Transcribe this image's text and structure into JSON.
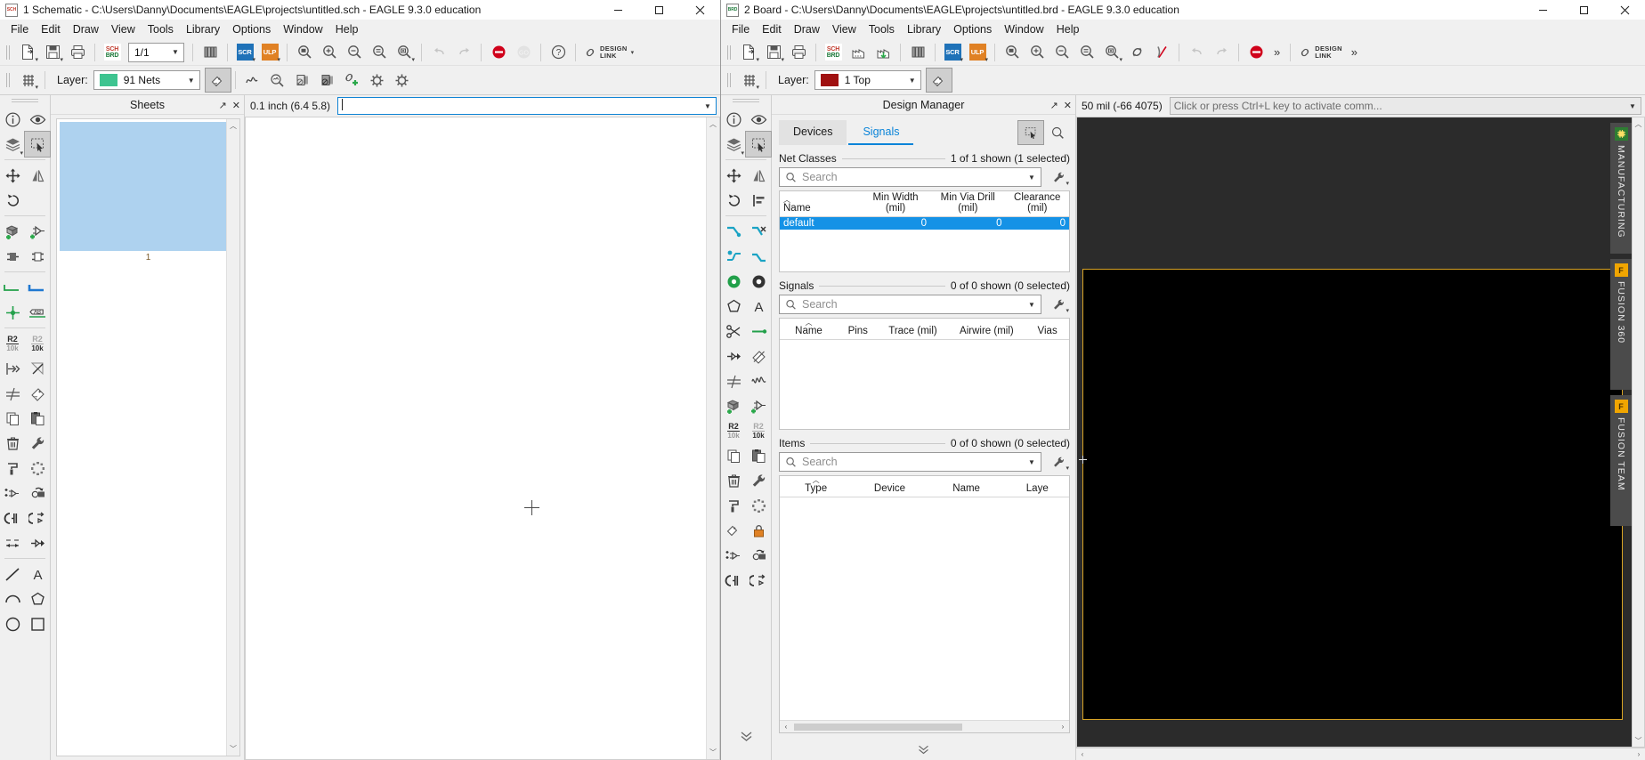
{
  "schematic_window": {
    "title": "1 Schematic - C:\\Users\\Danny\\Documents\\EAGLE\\projects\\untitled.sch - EAGLE 9.3.0 education",
    "title_icon": "sch-file-icon",
    "window_buttons": {
      "minimize": "minimize-icon",
      "maximize": "maximize-icon",
      "close": "close-icon"
    },
    "menu": [
      "File",
      "Edit",
      "Draw",
      "View",
      "Tools",
      "Library",
      "Options",
      "Window",
      "Help"
    ],
    "toolbar": {
      "buttons": [
        {
          "name": "new-file-icon",
          "kind": "newfile"
        },
        {
          "name": "save-icon",
          "kind": "save"
        },
        {
          "name": "print-icon",
          "kind": "print"
        },
        {
          "name": "switch-to-board-icon",
          "kind": "schbrd"
        }
      ],
      "sheet_selector": "1/1",
      "library_icon": "library-icon",
      "script_label": "SCR",
      "ulp_label": "ULP",
      "zoom_buttons": [
        "zoom-fit-icon",
        "zoom-in-icon",
        "zoom-out-icon",
        "zoom-select-icon",
        "zoom-redraw-icon"
      ],
      "undo_icon": "undo-icon",
      "redo_icon": "redo-icon",
      "stop_icon": "stop-icon",
      "go_icon": "go-icon",
      "help_icon": "help-icon",
      "design_link_line1": "DESIGN",
      "design_link_line2": "LINK"
    },
    "layerbar": {
      "grid_icon": "grid-icon",
      "layer_label": "Layer:",
      "layer_value": "91 Nets",
      "layer_color": "#3ec490",
      "layer_settings_icon": "layer-settings-icon",
      "tools": [
        "signal-icon",
        "inspect-icon",
        "erc-icon",
        "drc-icon",
        "attach-icon",
        "gear-icon",
        "gear-alt-icon"
      ]
    },
    "palette": [
      [
        "info-icon",
        "show-icon"
      ],
      [
        "layers-icon",
        "group-select-icon"
      ],
      [
        "move-icon",
        "mirror-icon"
      ],
      [
        "rotate-icon",
        null
      ],
      [
        "add-part-icon",
        "add-gate-icon"
      ],
      [
        "device-icon",
        "package-icon"
      ],
      [
        "net-icon",
        "bus-icon"
      ],
      [
        "junction-icon",
        "label-icon"
      ],
      [
        "value-icon",
        "name-icon"
      ],
      [
        "pin-icon",
        "line-icon"
      ],
      [
        "split-icon",
        "smash-icon"
      ],
      [
        "copy-icon",
        "paste-icon"
      ],
      [
        "delete-icon",
        "wrench-icon"
      ],
      [
        "paint-icon",
        "dots-icon"
      ],
      [
        "replicate-icon",
        "change-icon"
      ],
      [
        "invoke-icon",
        "gateswap-icon"
      ],
      [
        "dimension-icon",
        "connect-icon"
      ],
      [
        "line-tool-icon",
        "text-icon"
      ],
      [
        "arc-icon",
        "polygon-icon"
      ],
      [
        "circle-icon",
        "rect-icon"
      ]
    ],
    "sheets_panel": {
      "title": "Sheets",
      "float_icon": "float-icon",
      "close_icon": "close-icon",
      "sheet_number": "1"
    },
    "command_bar": {
      "coordinate": "0.1 inch (6.4 5.8)",
      "input_value": "",
      "dropdown_icon": "chevron-down-icon"
    }
  },
  "board_window": {
    "title": "2 Board - C:\\Users\\Danny\\Documents\\EAGLE\\projects\\untitled.brd - EAGLE 9.3.0 education",
    "title_icon": "brd-file-icon",
    "window_buttons": {
      "minimize": "minimize-icon",
      "maximize": "maximize-icon",
      "close": "close-icon"
    },
    "menu": [
      "File",
      "Edit",
      "Draw",
      "View",
      "Tools",
      "Library",
      "Options",
      "Window",
      "Help"
    ],
    "toolbar": {
      "buttons": [
        "new-file-icon",
        "save-icon",
        "print-icon",
        "switch-to-schematic-icon",
        "cam-icon",
        "cam-download-icon",
        "library-icon"
      ],
      "script_label": "SCR",
      "ulp_label": "ULP",
      "zoom_buttons": [
        "zoom-fit-icon",
        "zoom-in-icon",
        "zoom-out-icon",
        "zoom-select-icon",
        "zoom-redraw-icon"
      ],
      "ratsnest_icon": "ratsnest-icon",
      "autorouter-icon": "autorouter-icon",
      "undo_icon": "undo-icon",
      "redo_icon": "redo-icon",
      "stop_icon": "stop-icon",
      "overflow_icon": "chevron-double-right-icon",
      "design_link_line1": "DESIGN",
      "design_link_line2": "LINK",
      "overflow2_icon": "chevron-double-right-icon"
    },
    "layerbar": {
      "grid_icon": "grid-icon",
      "layer_label": "Layer:",
      "layer_value": "1 Top",
      "layer_color": "#a01010",
      "layer_settings_icon": "layer-settings-icon"
    },
    "palette": [
      [
        "info-icon",
        "show-icon"
      ],
      [
        "layers-icon",
        "group-select-icon"
      ],
      [
        "move-icon",
        "mirror-icon"
      ],
      [
        "rotate-icon",
        "align-icon"
      ],
      [
        "route-icon",
        "ripup-icon"
      ],
      [
        "via-icon",
        "wire-icon"
      ],
      [
        "polygon-fill-icon",
        "circle-fill-icon"
      ],
      [
        "hexagon-icon",
        "text-icon"
      ],
      [
        "scissors-icon",
        "connect-icon"
      ],
      [
        "dimension-icon",
        "pen-icon"
      ],
      [
        "meander-icon",
        "wave-icon"
      ],
      [
        "add-part-icon",
        "add-gate-icon"
      ],
      [
        "value-icon",
        "name-icon"
      ],
      [
        "copy-icon",
        "paste-icon"
      ],
      [
        "delete-icon",
        "wrench-icon"
      ],
      [
        "paint-icon",
        "dots-icon"
      ],
      [
        "label-icon",
        "lock-icon"
      ],
      [
        "replicate-icon",
        "change-icon"
      ],
      [
        "invoke-icon",
        "swap-icon"
      ],
      [
        "collapse-icon",
        null
      ]
    ],
    "design_manager": {
      "title": "Design Manager",
      "float_icon": "float-icon",
      "close_icon": "close-icon",
      "tabs": [
        {
          "label": "Devices",
          "active": false
        },
        {
          "label": "Signals",
          "active": true
        }
      ],
      "tab_tools": [
        "select-tool-icon",
        "zoom-tool-icon"
      ],
      "sections": [
        {
          "title": "Net Classes",
          "count": "1 of 1 shown (1 selected)",
          "search_placeholder": "Search",
          "search_icon": "search-icon",
          "dropdown_icon": "chevron-down-icon",
          "wrench_icon": "wrench-icon",
          "columns": [
            {
              "label": "Name",
              "sub": "",
              "sorted": true
            },
            {
              "label": "Min Width",
              "sub": "(mil)"
            },
            {
              "label": "Min Via Drill",
              "sub": "(mil)"
            },
            {
              "label": "Clearance",
              "sub": "(mil)"
            }
          ],
          "rows": [
            {
              "selected": true,
              "cells": [
                "default",
                "0",
                "0",
                "0"
              ]
            }
          ]
        },
        {
          "title": "Signals",
          "count": "0 of 0 shown (0 selected)",
          "search_placeholder": "Search",
          "search_icon": "search-icon",
          "dropdown_icon": "chevron-down-icon",
          "wrench_icon": "wrench-icon",
          "columns": [
            {
              "label": "Name",
              "sub": "",
              "sorted": true
            },
            {
              "label": "Pins",
              "sub": ""
            },
            {
              "label": "Trace (mil)",
              "sub": ""
            },
            {
              "label": "Airwire (mil)",
              "sub": ""
            },
            {
              "label": "Vias",
              "sub": ""
            }
          ],
          "rows": []
        },
        {
          "title": "Items",
          "count": "0 of 0 shown (0 selected)",
          "search_placeholder": "Search",
          "search_icon": "search-icon",
          "dropdown_icon": "chevron-down-icon",
          "wrench_icon": "wrench-icon",
          "columns": [
            {
              "label": "Type",
              "sub": "",
              "sorted": true
            },
            {
              "label": "Device",
              "sub": ""
            },
            {
              "label": "Name",
              "sub": ""
            },
            {
              "label": "Laye",
              "sub": ""
            }
          ],
          "rows": []
        }
      ],
      "collapse_icon": "chevron-double-down-icon"
    },
    "command_bar": {
      "coordinate": "50 mil (-66 4075)",
      "input_placeholder": "Click or press Ctrl+L key to activate comm...",
      "dropdown_icon": "chevron-down-icon"
    },
    "side_tabs": [
      {
        "label": "MANUFACTURING",
        "icon": "chip-icon",
        "icon_color": "#2e7d32"
      },
      {
        "label": "FUSION 360",
        "icon": "fusion-icon",
        "icon_color": "#f0a500"
      },
      {
        "label": "FUSION TEAM",
        "icon": "fusion-icon",
        "icon_color": "#f0a500"
      }
    ],
    "canvas": {
      "background": "#2b2b2b",
      "board_fill": "#000000",
      "board_outline_color": "#d8a426"
    }
  }
}
